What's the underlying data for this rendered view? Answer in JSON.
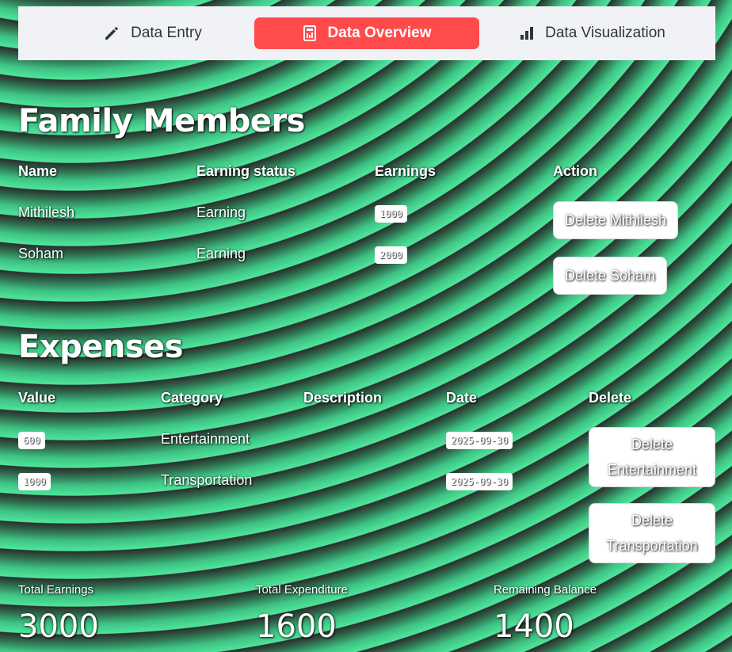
{
  "tabs": [
    {
      "label": "Data Entry",
      "icon": "pencil-icon"
    },
    {
      "label": "Data Overview",
      "icon": "calculator-icon",
      "active": true
    },
    {
      "label": "Data Visualization",
      "icon": "bar-chart-icon"
    }
  ],
  "accent_color": "#ff4b4b",
  "family": {
    "title": "Family Members",
    "headers": {
      "name": "Name",
      "status": "Earning status",
      "earnings": "Earnings",
      "action": "Action"
    },
    "rows": [
      {
        "name": "Mithilesh",
        "status": "Earning",
        "earnings": "1000",
        "action": "Delete Mithilesh"
      },
      {
        "name": "Soham",
        "status": "Earning",
        "earnings": "2000",
        "action": "Delete Soham"
      }
    ]
  },
  "expenses": {
    "title": "Expenses",
    "headers": {
      "value": "Value",
      "category": "Category",
      "description": "Description",
      "date": "Date",
      "delete": "Delete"
    },
    "rows": [
      {
        "value": "600",
        "category": "Entertainment",
        "description": "",
        "date": "2025-09-30",
        "delete": "Delete Entertainment"
      },
      {
        "value": "1000",
        "category": "Transportation",
        "description": "",
        "date": "2025-09-30",
        "delete": "Delete Transportation"
      }
    ]
  },
  "metrics": [
    {
      "label": "Total Earnings",
      "value": "3000"
    },
    {
      "label": "Total Expenditure",
      "value": "1600"
    },
    {
      "label": "Remaining Balance",
      "value": "1400"
    }
  ]
}
